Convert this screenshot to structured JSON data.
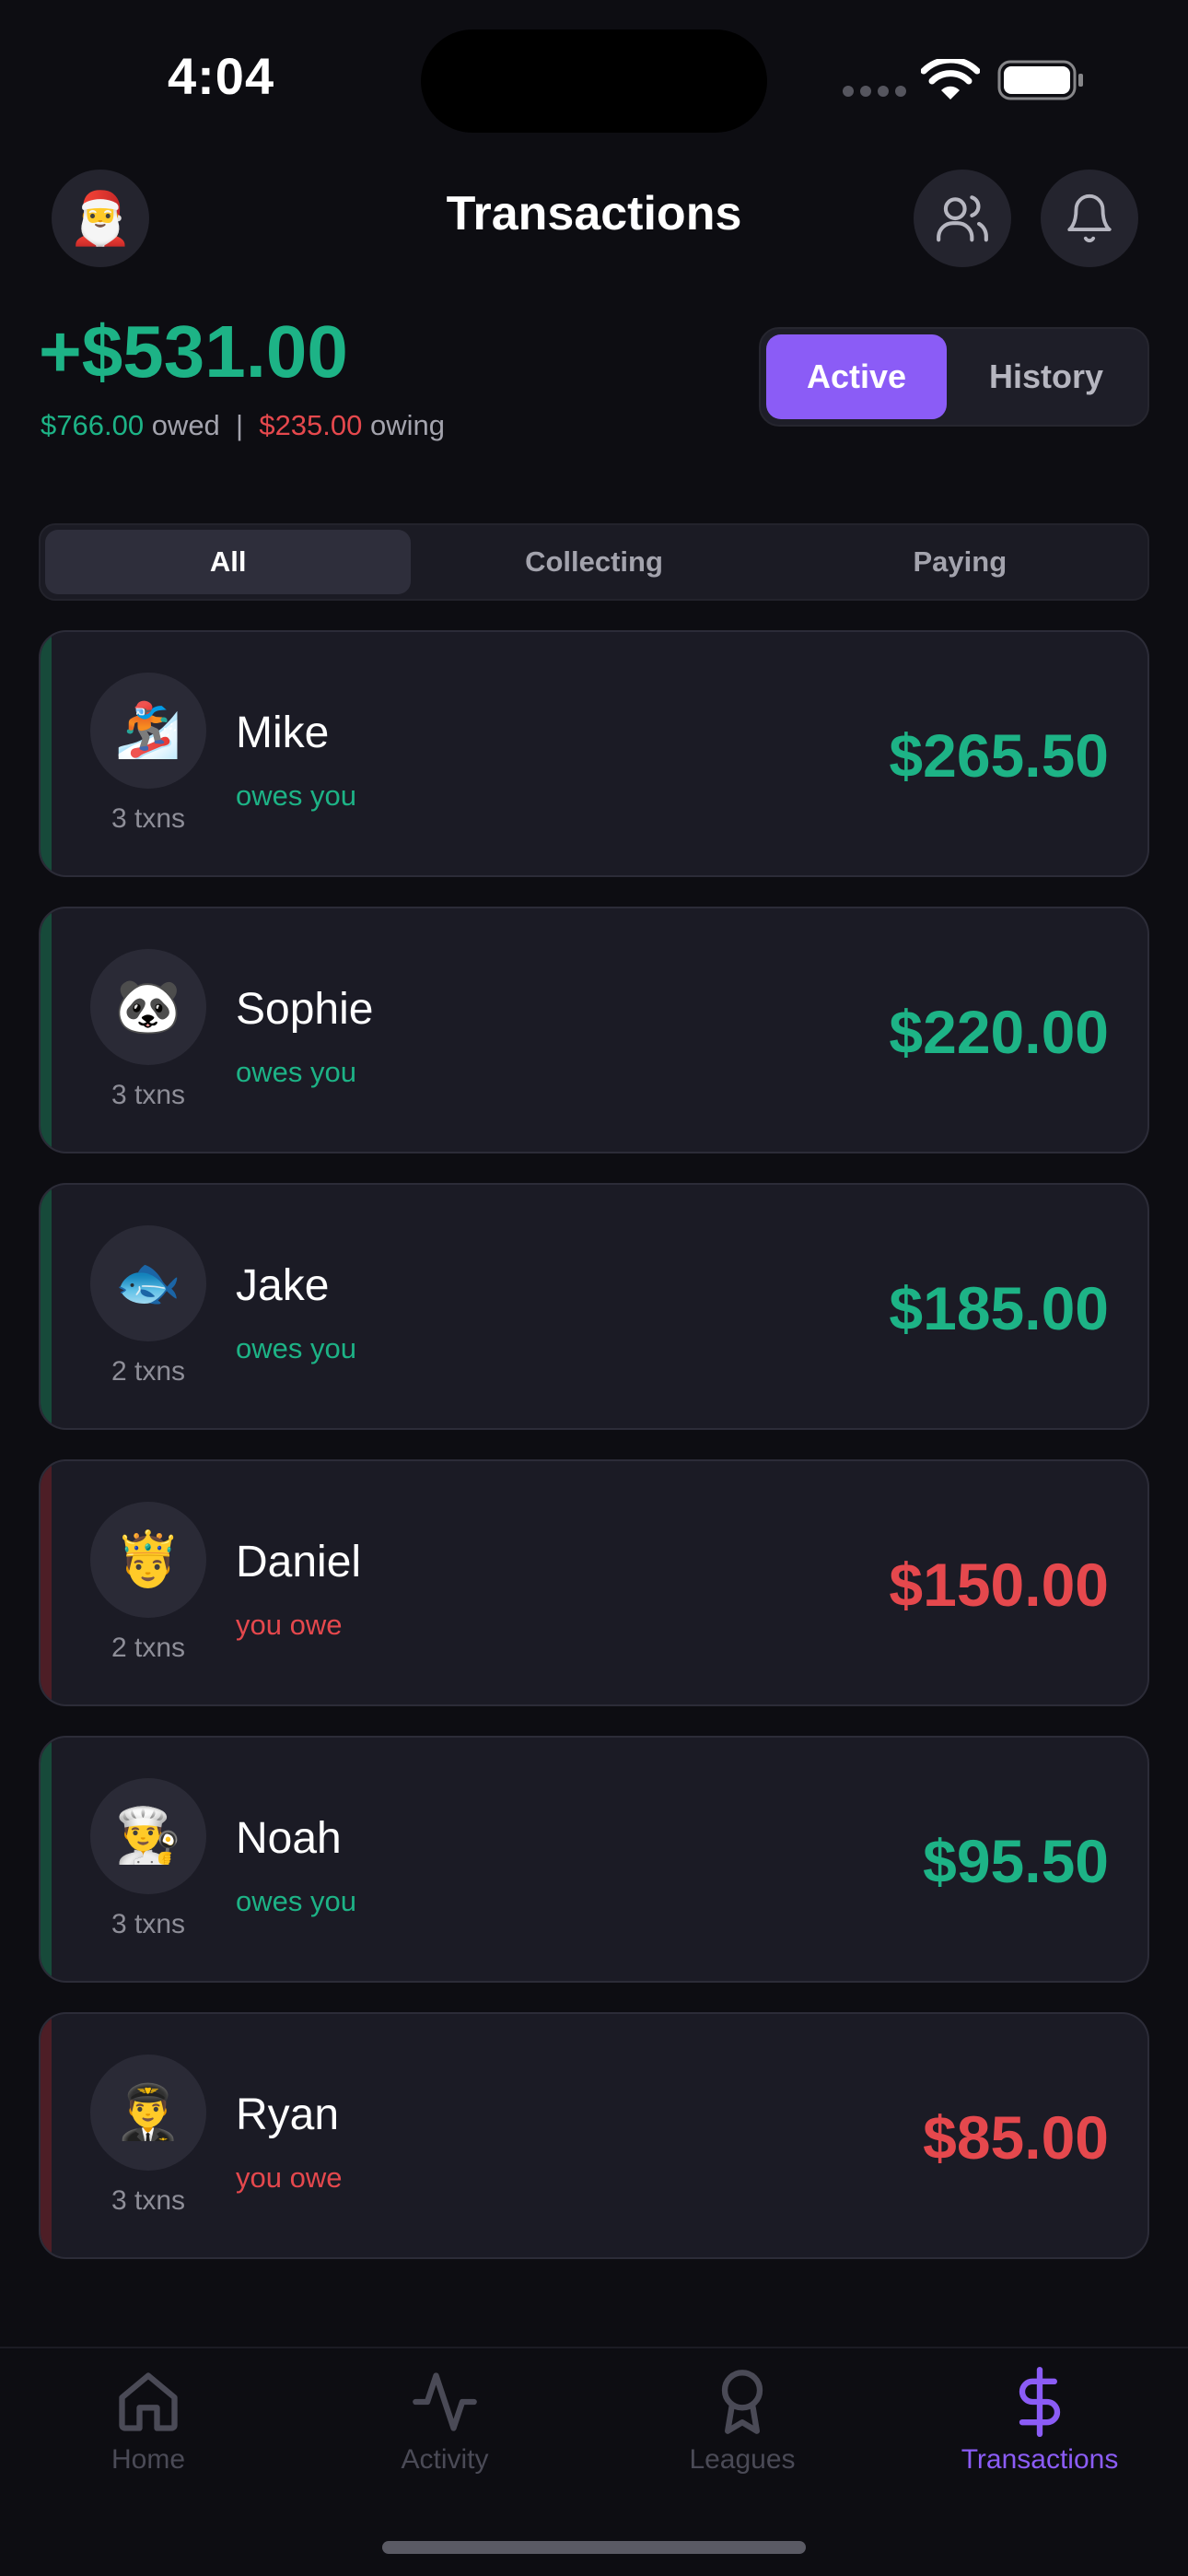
{
  "status_bar": {
    "time": "4:04"
  },
  "header": {
    "title": "Transactions",
    "avatar_emoji": "🎅",
    "friends_icon": "users-icon",
    "notifications_icon": "bell-icon"
  },
  "balance": {
    "net": "+$531.00",
    "owed_amount": "$766.00",
    "owed_label": "owed",
    "separator": "|",
    "owing_amount": "$235.00",
    "owing_label": "owing"
  },
  "toggle": {
    "active_label": "Active",
    "history_label": "History",
    "selected": "Active"
  },
  "filters": {
    "tabs": [
      "All",
      "Collecting",
      "Paying"
    ],
    "selected": "All"
  },
  "transactions": [
    {
      "name": "Mike",
      "emoji": "🏂",
      "txns": "3 txns",
      "relation": "owes you",
      "amount": "$265.50",
      "direction": "owes"
    },
    {
      "name": "Sophie",
      "emoji": "🐼",
      "txns": "3 txns",
      "relation": "owes you",
      "amount": "$220.00",
      "direction": "owes"
    },
    {
      "name": "Jake",
      "emoji": "🐟",
      "txns": "2 txns",
      "relation": "owes you",
      "amount": "$185.00",
      "direction": "owes"
    },
    {
      "name": "Daniel",
      "emoji": "🤴",
      "txns": "2 txns",
      "relation": "you owe",
      "amount": "$150.00",
      "direction": "owe"
    },
    {
      "name": "Noah",
      "emoji": "👨‍🍳",
      "txns": "3 txns",
      "relation": "owes you",
      "amount": "$95.50",
      "direction": "owes"
    },
    {
      "name": "Ryan",
      "emoji": "👨‍✈️",
      "txns": "3 txns",
      "relation": "you owe",
      "amount": "$85.00",
      "direction": "owe"
    }
  ],
  "tabbar": {
    "items": [
      {
        "label": "Home",
        "icon": "home-icon"
      },
      {
        "label": "Activity",
        "icon": "activity-icon"
      },
      {
        "label": "Leagues",
        "icon": "award-icon"
      },
      {
        "label": "Transactions",
        "icon": "dollar-icon"
      }
    ],
    "selected": "Transactions"
  },
  "colors": {
    "accent": "#8b5cf6",
    "positive": "#1db386",
    "negative": "#e5484d",
    "background": "#0d0d12"
  }
}
